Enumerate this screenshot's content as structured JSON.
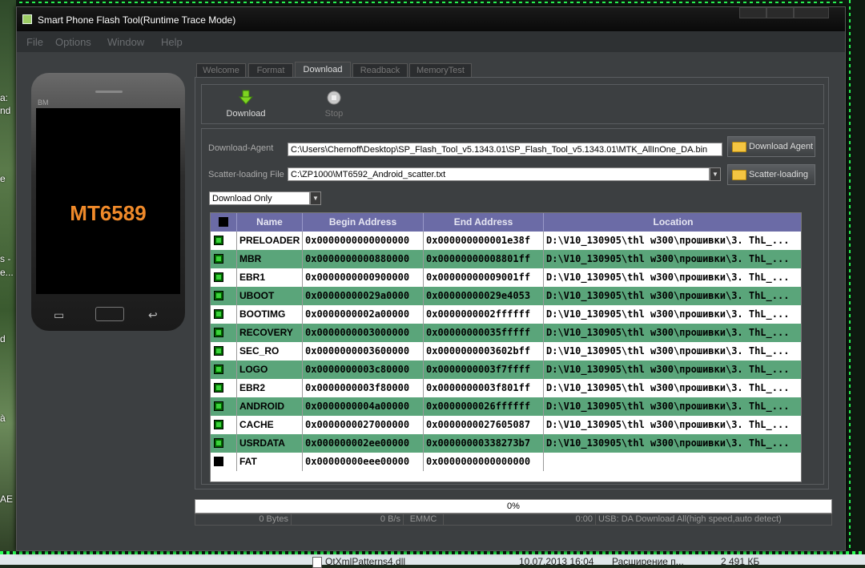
{
  "window": {
    "title": "Smart Phone Flash Tool(Runtime Trace Mode)"
  },
  "menu": [
    "File",
    "Options",
    "Window",
    "Help"
  ],
  "phone": {
    "brand": "BM",
    "model": "MT6589"
  },
  "tabs": [
    "Welcome",
    "Format",
    "Download",
    "Readback",
    "MemoryTest"
  ],
  "active_tab": "Download",
  "toolbar": {
    "download_label": "Download",
    "stop_label": "Stop"
  },
  "form": {
    "download_agent_label": "Download-Agent",
    "download_agent_value": "C:\\Users\\Chernoff\\Desktop\\SP_Flash_Tool_v5.1343.01\\SP_Flash_Tool_v5.1343.01\\MTK_AllInOne_DA.bin",
    "scatter_label": "Scatter-loading File",
    "scatter_value": "C:\\ZP1000\\MT6592_Android_scatter.txt",
    "download_agent_button": "Download Agent",
    "scatter_button": "Scatter-loading",
    "mode_value": "Download Only"
  },
  "table": {
    "headers": [
      "Name",
      "Begin Address",
      "End Address",
      "Location"
    ],
    "rows": [
      {
        "checked": true,
        "name": "PRELOADER",
        "begin": "0x0000000000000000",
        "end": "0x000000000001e38f",
        "location": "D:\\V10_130905\\thl w300\\прошивки\\3. ThL_..."
      },
      {
        "checked": true,
        "name": "MBR",
        "begin": "0x0000000000880000",
        "end": "0x00000000008801ff",
        "location": "D:\\V10_130905\\thl w300\\прошивки\\3. ThL_..."
      },
      {
        "checked": true,
        "name": "EBR1",
        "begin": "0x0000000000900000",
        "end": "0x00000000009001ff",
        "location": "D:\\V10_130905\\thl w300\\прошивки\\3. ThL_..."
      },
      {
        "checked": true,
        "name": "UBOOT",
        "begin": "0x00000000029a0000",
        "end": "0x00000000029e4053",
        "location": "D:\\V10_130905\\thl w300\\прошивки\\3. ThL_..."
      },
      {
        "checked": true,
        "name": "BOOTIMG",
        "begin": "0x0000000002a00000",
        "end": "0x0000000002ffffff",
        "location": "D:\\V10_130905\\thl w300\\прошивки\\3. ThL_..."
      },
      {
        "checked": true,
        "name": "RECOVERY",
        "begin": "0x0000000003000000",
        "end": "0x00000000035fffff",
        "location": "D:\\V10_130905\\thl w300\\прошивки\\3. ThL_..."
      },
      {
        "checked": true,
        "name": "SEC_RO",
        "begin": "0x0000000003600000",
        "end": "0x0000000003602bff",
        "location": "D:\\V10_130905\\thl w300\\прошивки\\3. ThL_..."
      },
      {
        "checked": true,
        "name": "LOGO",
        "begin": "0x0000000003c80000",
        "end": "0x0000000003f7ffff",
        "location": "D:\\V10_130905\\thl w300\\прошивки\\3. ThL_..."
      },
      {
        "checked": true,
        "name": "EBR2",
        "begin": "0x0000000003f80000",
        "end": "0x0000000003f801ff",
        "location": "D:\\V10_130905\\thl w300\\прошивки\\3. ThL_..."
      },
      {
        "checked": true,
        "name": "ANDROID",
        "begin": "0x0000000004a00000",
        "end": "0x0000000026ffffff",
        "location": "D:\\V10_130905\\thl w300\\прошивки\\3. ThL_..."
      },
      {
        "checked": true,
        "name": "CACHE",
        "begin": "0x0000000027000000",
        "end": "0x0000000027605087",
        "location": "D:\\V10_130905\\thl w300\\прошивки\\3. ThL_..."
      },
      {
        "checked": true,
        "name": "USRDATA",
        "begin": "0x000000002ee00000",
        "end": "0x00000000338273b7",
        "location": "D:\\V10_130905\\thl w300\\прошивки\\3. ThL_..."
      },
      {
        "checked": false,
        "name": "FAT",
        "begin": "0x00000000eee00000",
        "end": "0x0000000000000000",
        "location": ""
      }
    ]
  },
  "progress": {
    "text": "0%",
    "fraction": 0
  },
  "status": {
    "bytes": "0 Bytes",
    "rate": "0 B/s",
    "storage": "EMMC",
    "time": "0:00",
    "message": "USB: DA Download All(high speed,auto detect)"
  },
  "taskbar": {
    "file_name": "QtXmlPatterns4.dll",
    "file_date": "10.07.2013 16:04",
    "file_type": "Расширение п...",
    "file_size": "2 491 КБ"
  },
  "desktop_icon_labels": [
    "a:",
    "nd",
    "e",
    "s -",
    "e...",
    "d",
    "à",
    "AE"
  ],
  "colors": {
    "row_alt": "#5aa57a",
    "header": "#6b6ba6",
    "model_text": "#f08a2a",
    "accent_green": "#2aff55"
  }
}
